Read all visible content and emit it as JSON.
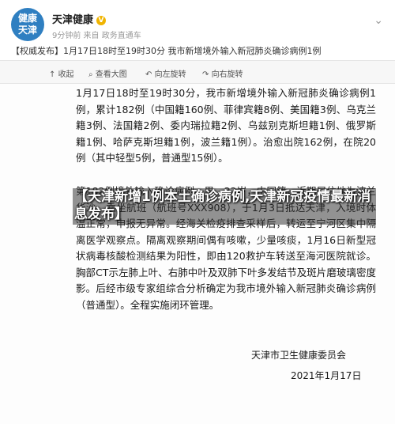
{
  "account": {
    "avatar_line1": "健康",
    "avatar_line2": "天津",
    "name": "天津健康",
    "verified_icon": "verified-badge-icon",
    "meta": "9分钟前 来自 政务直通车",
    "more_icon": "more-dots-icon"
  },
  "post": {
    "title": "【权威发布】1月17日18时至19时30分 我市新增境外输入新冠肺炎确诊病例1例"
  },
  "toolbar": {
    "collapse": "收起",
    "view_image": "查看大图",
    "rotate_left": "向左旋转",
    "rotate_right": "向右旋转"
  },
  "document": {
    "paragraph1": "1月17日18时至19时30分，我市新增境外输入新冠肺炎确诊病例1例，累计182例（中国籍160例、菲律宾籍8例、美国籍3例、乌克兰籍3例、法国籍2例、委内瑞拉籍2例、乌兹别克斯坦籍1例、俄罗斯籍1例、哈萨克斯坦籍1例，波兰籍1例）。治愈出院162例，在院20例（其中轻型5例，普通型15例）。",
    "paragraph2": "第182例境外输入确诊病例，男，22岁，中国籍，近期居住地为波兰华沙，乘坐航班（航班号XXX908），于1月3日抵达天津，入境时体温正常，申报无异常。经海关检疫排查采样后，转运至宁河区集中隔离医学观察点。隔离观察期间偶有咳嗽，少量咳痰，1月16日新型冠状病毒核酸检测结果为阳性，即由120救护车转送至海河医院就诊。胸部CT示左肺上叶、右肺中叶及双肺下叶多发结节及斑片磨玻璃密度影。后经市级专家组综合分析确定为我市境外输入新冠肺炎确诊病例（普通型）。全程实施闭环管理。",
    "signature_org": "天津市卫生健康委员会",
    "signature_date": "2021年1月17日"
  },
  "overlay": {
    "headline": "【天津新增1例本土确诊病例,天津新冠疫情最新消息发布】"
  },
  "colors": {
    "avatar_bg": "#2f7fc1",
    "verified": "#f0b400",
    "toolbar_bg": "#f7f7f7"
  }
}
